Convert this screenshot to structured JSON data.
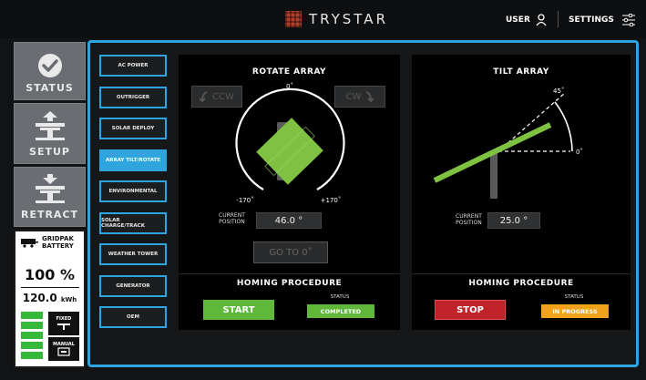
{
  "header": {
    "brand": "TRYSTAR",
    "user_label": "USER",
    "settings_label": "SETTINGS"
  },
  "sidebar": {
    "status_label": "STATUS",
    "setup_label": "SETUP",
    "retract_label": "RETRACT"
  },
  "battery": {
    "title_line1": "GRIDPAK",
    "title_line2": "BATTERY",
    "percent": "100 %",
    "capacity": "120.0",
    "capacity_unit": "kWh",
    "level_bars": 5,
    "mode_fixed": "FIXED",
    "mode_manual": "MANUAL"
  },
  "menu": {
    "items": [
      {
        "label": "AC POWER"
      },
      {
        "label": "OUTRIGGER"
      },
      {
        "label": "SOLAR DEPLOY"
      },
      {
        "label": "ARRAY TILT/ROTATE"
      },
      {
        "label": "ENVIRONMENTAL"
      },
      {
        "label": "SOLAR CHARGE/TRACK"
      },
      {
        "label": "WEATHER TOWER"
      },
      {
        "label": "GENERATOR"
      },
      {
        "label": "OEM"
      }
    ],
    "active_index": 3
  },
  "rotate": {
    "title": "ROTATE ARRAY",
    "ccw_label": "CCW",
    "cw_label": "CW",
    "angle_top": "0˚",
    "angle_left": "-170˚",
    "angle_right": "+170˚",
    "current_label_line1": "CURRENT",
    "current_label_line2": "POSITION",
    "current_value": "46.0 °",
    "goto_label": "GO TO 0˚",
    "homing_title": "HOMING PROCEDURE",
    "status_label": "STATUS",
    "button_label": "START",
    "status_value": "COMPLETED"
  },
  "tilt": {
    "title": "TILT ARRAY",
    "angle_45": "45˚",
    "angle_0": "0˚",
    "current_label_line1": "CURRENT",
    "current_label_line2": "POSITION",
    "current_value": "25.0 °",
    "homing_title": "HOMING PROCEDURE",
    "status_label": "STATUS",
    "button_label": "STOP",
    "status_value": "IN PROGRESS"
  },
  "colors": {
    "accent": "#2ea6dd",
    "green": "#7fc242",
    "start_green": "#5fb83a",
    "stop_red": "#c0222a",
    "progress_orange": "#f0a21c",
    "brand_red": "#b3402c"
  }
}
